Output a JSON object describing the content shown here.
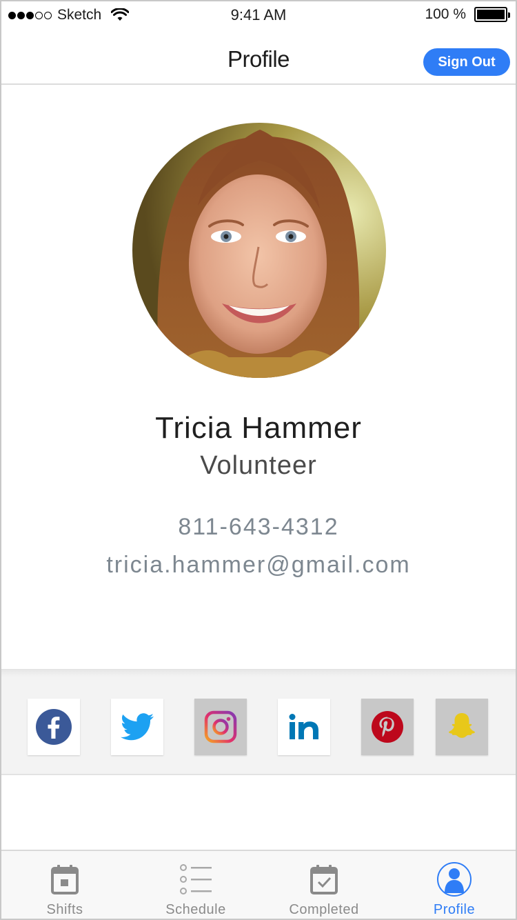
{
  "status_bar": {
    "carrier": "Sketch",
    "time": "9:41 AM",
    "battery": "100 %"
  },
  "nav": {
    "title": "Profile",
    "sign_out_label": "Sign Out"
  },
  "profile": {
    "name": "Tricia Hammer",
    "role": "Volunteer",
    "phone": "811-643-4312",
    "email": "tricia.hammer@gmail.com"
  },
  "social": [
    {
      "name": "facebook",
      "icon": "facebook-icon",
      "color": "#3b5998",
      "style": "white"
    },
    {
      "name": "twitter",
      "icon": "twitter-icon",
      "color": "#1da1f2",
      "style": "white"
    },
    {
      "name": "instagram",
      "icon": "instagram-icon",
      "color": "#c13584",
      "style": "grey"
    },
    {
      "name": "linkedin",
      "icon": "linkedin-icon",
      "color": "#0077b5",
      "style": "white"
    },
    {
      "name": "pinterest",
      "icon": "pinterest-icon",
      "color": "#bd081c",
      "style": "grey"
    },
    {
      "name": "snapchat",
      "icon": "snapchat-icon",
      "color": "#e8c81a",
      "style": "grey"
    }
  ],
  "tabs": [
    {
      "label": "Shifts",
      "icon": "calendar-icon",
      "active": false
    },
    {
      "label": "Schedule",
      "icon": "list-icon",
      "active": false
    },
    {
      "label": "Completed",
      "icon": "calendar-check-icon",
      "active": false
    },
    {
      "label": "Profile",
      "icon": "person-icon",
      "active": true
    }
  ],
  "colors": {
    "accent": "#2f7df6",
    "muted_text": "#7d8790",
    "inactive_tab": "#8a8a8a"
  }
}
